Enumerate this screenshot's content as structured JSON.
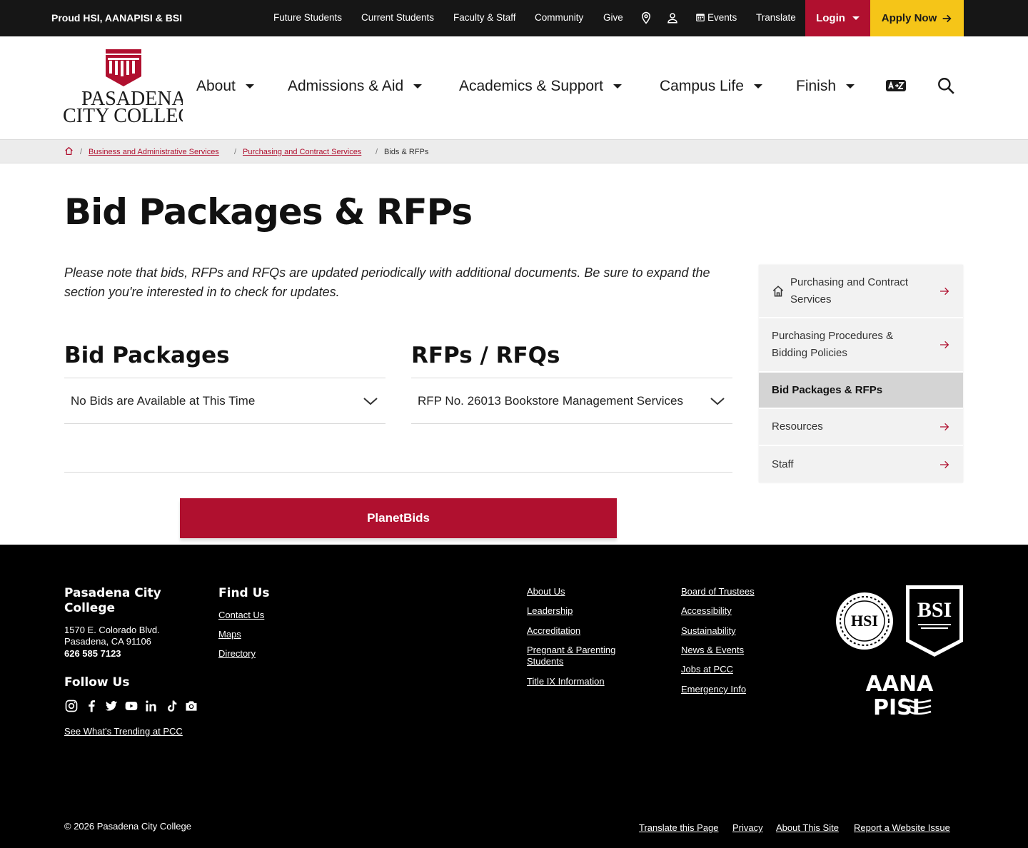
{
  "topbar": {
    "proud": "Proud HSI, AANAPISI & BSI",
    "links": [
      "Future Students",
      "Current Students",
      "Faculty & Staff",
      "Community",
      "Give"
    ],
    "events": "Events",
    "translate": "Translate",
    "login": "Login",
    "apply": "Apply Now"
  },
  "logo": {
    "line1": "PASADENA",
    "line2": "CITY COLLEGE"
  },
  "nav": [
    "About",
    "Admissions & Aid",
    "Academics & Support",
    "Campus Life",
    "Finish"
  ],
  "breadcrumb": {
    "items": [
      "Business and Administrative Services",
      "Purchasing and Contract Services"
    ],
    "current": "Bids & RFPs"
  },
  "page": {
    "title": "Bid Packages & RFPs",
    "note": "Please note that bids, RFPs and RFQs are updated periodically with additional documents. Be sure to expand the section you're interested in to check for updates.",
    "bid_title": "Bid Packages",
    "bid_item": "No Bids are Available at This Time",
    "rfp_title": "RFPs / RFQs",
    "rfp_item": "RFP No. 26013 Bookstore Management Services",
    "button": "PlanetBids"
  },
  "sidebar": [
    "Purchasing and Contract Services",
    "Purchasing Procedures & Bidding Policies",
    "Bid Packages & RFPs",
    "Resources",
    "Staff"
  ],
  "footer": {
    "college": "Pasadena City College",
    "address1": "1570 E. Colorado Blvd.",
    "address2": "Pasadena, CA 91106",
    "phone": "626 585 7123",
    "follow": "Follow Us",
    "trending": "See What's Trending at PCC",
    "find_us": "Find Us",
    "find_links": [
      "Contact Us",
      "Maps",
      "Directory"
    ],
    "col3": [
      "About Us",
      "Leadership",
      "Accreditation",
      "Pregnant & Parenting Students",
      "Title IX Information"
    ],
    "col4": [
      "Board of Trustees",
      "Accessibility",
      "Sustainability",
      "News & Events",
      "Jobs at PCC",
      "Emergency Info"
    ],
    "badges": {
      "hsi": "HSI",
      "bsi": "BSI",
      "aana": "AANA",
      "pisi": "PISI"
    },
    "copyright": "© 2026 Pasadena City College",
    "bottom_links": [
      "Translate this Page",
      "Privacy",
      "About This Site",
      "Report a Website Issue"
    ]
  },
  "colors": {
    "brand_red": "#b0102f",
    "brand_yellow": "#f5c518",
    "dark": "#161616"
  }
}
